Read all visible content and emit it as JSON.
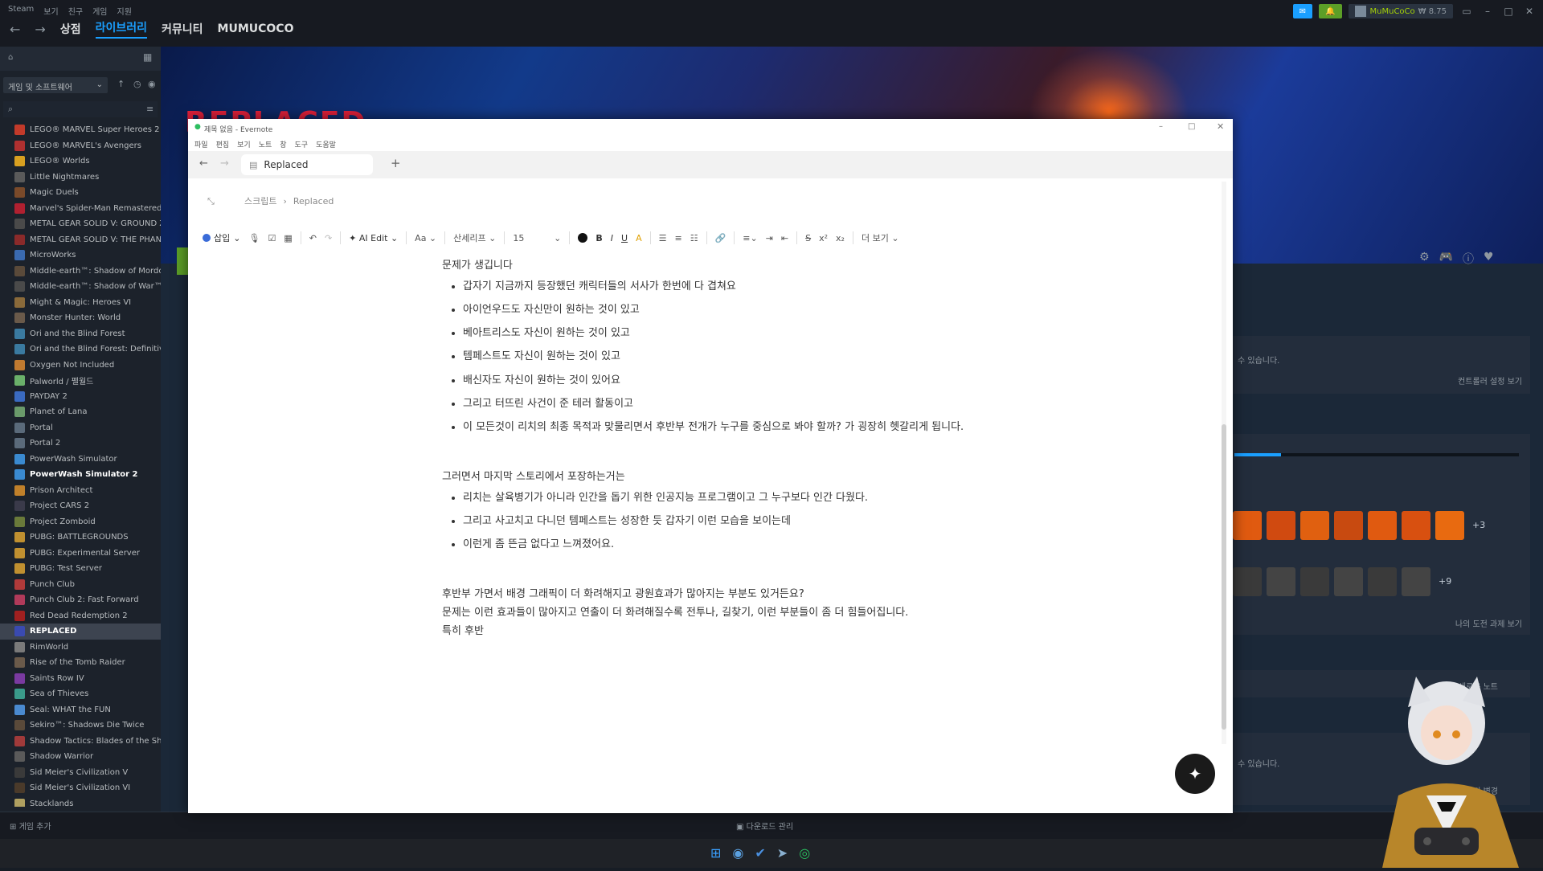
{
  "steam": {
    "menu": [
      "Steam",
      "보기",
      "친구",
      "게임",
      "지원"
    ],
    "nav": [
      "상점",
      "라이브러리",
      "커뮤니티",
      "MUMUCOCO"
    ],
    "account": "MuMuCoCo",
    "wallet": "₩ 8.75",
    "filter": "게임 및 소프트웨어",
    "games": [
      {
        "name": "LEGO® MARVEL Super Heroes 2",
        "color": "#c23a2a"
      },
      {
        "name": "LEGO® MARVEL's Avengers",
        "color": "#b03030"
      },
      {
        "name": "LEGO® Worlds",
        "color": "#d8a020"
      },
      {
        "name": "Little Nightmares",
        "color": "#5a5a5a"
      },
      {
        "name": "Magic Duels",
        "color": "#7a4a2a"
      },
      {
        "name": "Marvel's Spider-Man Remastered",
        "color": "#b02030"
      },
      {
        "name": "METAL GEAR SOLID V: GROUND ZEROES",
        "color": "#4a4a4a"
      },
      {
        "name": "METAL GEAR SOLID V: THE PHANTOM PAIN",
        "color": "#8a2a2a"
      },
      {
        "name": "MicroWorks",
        "color": "#3a6ab0"
      },
      {
        "name": "Middle-earth™: Shadow of Mordor",
        "color": "#5a4a3a"
      },
      {
        "name": "Middle-earth™: Shadow of War™",
        "color": "#4a4a4a"
      },
      {
        "name": "Might & Magic: Heroes VI",
        "color": "#8a6a3a"
      },
      {
        "name": "Monster Hunter: World",
        "color": "#6a5a4a"
      },
      {
        "name": "Ori and the Blind Forest",
        "color": "#3a7aa0"
      },
      {
        "name": "Ori and the Blind Forest: Definitive Edition",
        "color": "#3a7aa0"
      },
      {
        "name": "Oxygen Not Included",
        "color": "#c07a30"
      },
      {
        "name": "Palworld / 펠월드",
        "color": "#6ab06a"
      },
      {
        "name": "PAYDAY 2",
        "color": "#3a6ac0"
      },
      {
        "name": "Planet of Lana",
        "color": "#6a9a6a"
      },
      {
        "name": "Portal",
        "color": "#5a6a7a"
      },
      {
        "name": "Portal 2",
        "color": "#5a6a7a"
      },
      {
        "name": "PowerWash Simulator",
        "color": "#3a8ad0"
      },
      {
        "name": "PowerWash Simulator 2",
        "color": "#3a8ad0",
        "bold": true
      },
      {
        "name": "Prison Architect",
        "color": "#c0802a"
      },
      {
        "name": "Project CARS 2",
        "color": "#3a3a4a"
      },
      {
        "name": "Project Zomboid",
        "color": "#6a7a3a"
      },
      {
        "name": "PUBG: BATTLEGROUNDS",
        "color": "#c09030"
      },
      {
        "name": "PUBG: Experimental Server",
        "color": "#c09030"
      },
      {
        "name": "PUBG: Test Server",
        "color": "#c09030"
      },
      {
        "name": "Punch Club",
        "color": "#b03a3a"
      },
      {
        "name": "Punch Club 2: Fast Forward",
        "color": "#b03a5a"
      },
      {
        "name": "Red Dead Redemption 2",
        "color": "#a02020"
      },
      {
        "name": "REPLACED",
        "color": "#3a4ab0",
        "selected": true
      },
      {
        "name": "RimWorld",
        "color": "#7a7a7a"
      },
      {
        "name": "Rise of the Tomb Raider",
        "color": "#6a5a4a"
      },
      {
        "name": "Saints Row IV",
        "color": "#7a3aa0"
      },
      {
        "name": "Sea of Thieves",
        "color": "#3a9a8a"
      },
      {
        "name": "Seal: WHAT the FUN",
        "color": "#4a8ad0"
      },
      {
        "name": "Sekiro™: Shadows Die Twice",
        "color": "#5a4a3a"
      },
      {
        "name": "Shadow Tactics: Blades of the Shogun",
        "color": "#a03a3a"
      },
      {
        "name": "Shadow Warrior",
        "color": "#5a5a5a"
      },
      {
        "name": "Sid Meier's Civilization V",
        "color": "#3a3a3a"
      },
      {
        "name": "Sid Meier's Civilization VI",
        "color": "#4a3a2a"
      },
      {
        "name": "Stacklands",
        "color": "#b0a060"
      }
    ],
    "add_game": "게임 추가",
    "downloads": "다운로드 관리",
    "hero_title": "REPLACED",
    "right_texts": {
      "controller_note": "수 있습니다.",
      "controller_link": "컨트롤러 설정 보기",
      "achievements_more_1": "+3",
      "achievements_more_2": "+9",
      "achievements_link": "나의 도전 과제 보기",
      "new_note": "새로운 노트",
      "bottom_note": "수 있습니다.",
      "bottom_link": "기 변경"
    }
  },
  "evernote": {
    "window_title": "제목 없음 - Evernote",
    "menu": [
      "파일",
      "편집",
      "보기",
      "노트",
      "창",
      "도구",
      "도움말"
    ],
    "tab_title": "Replaced",
    "tab_add": "+",
    "breadcrumb_parent": "스크립트",
    "breadcrumb_current": "Replaced",
    "toolbar": {
      "insert": "삽입",
      "ai_edit": "AI Edit",
      "text_style": "Aa",
      "font": "산세리프",
      "size": "15",
      "more": "더 보기"
    },
    "body": {
      "heading1": "문제가 생깁니다",
      "list1": [
        "갑자기 지금까지 등장했던 캐릭터들의 서사가 한번에 다 겹쳐요",
        "아이언우드도 자신만이 원하는 것이 있고",
        "베아트리스도 자신이 원하는 것이 있고",
        "템페스트도 자신이 원하는 것이 있고",
        "배신자도 자신이 원하는 것이 있어요",
        "그리고 터뜨린 사건이 준 테러 활동이고",
        "이 모든것이 리치의 최종 목적과 맞물리면서 후반부 전개가 누구를 중심으로 봐야 할까? 가 굉장히 헷갈리게 됩니다."
      ],
      "heading2": "그러면서 마지막 스토리에서 포장하는거는",
      "list2": [
        "리치는 살육병기가 아니라 인간을 돕기 위한 인공지능 프로그램이고 그 누구보다 인간 다웠다.",
        "그리고 사고치고 다니던 템페스트는 성장한 듯 갑자기 이런 모습을 보이는데",
        "이런게 좀 뜬금 없다고 느껴졌어요."
      ],
      "para1": "후반부 가면서 배경 그래픽이 더 화려해지고 광원효과가 많아지는 부분도 있거든요?",
      "para2": "문제는 이런 효과들이 많아지고 연출이 더 화려해질수록 전투나, 길찾기, 이런 부분들이 좀 더 힘들어집니다.",
      "para3": "특히 후반"
    }
  }
}
